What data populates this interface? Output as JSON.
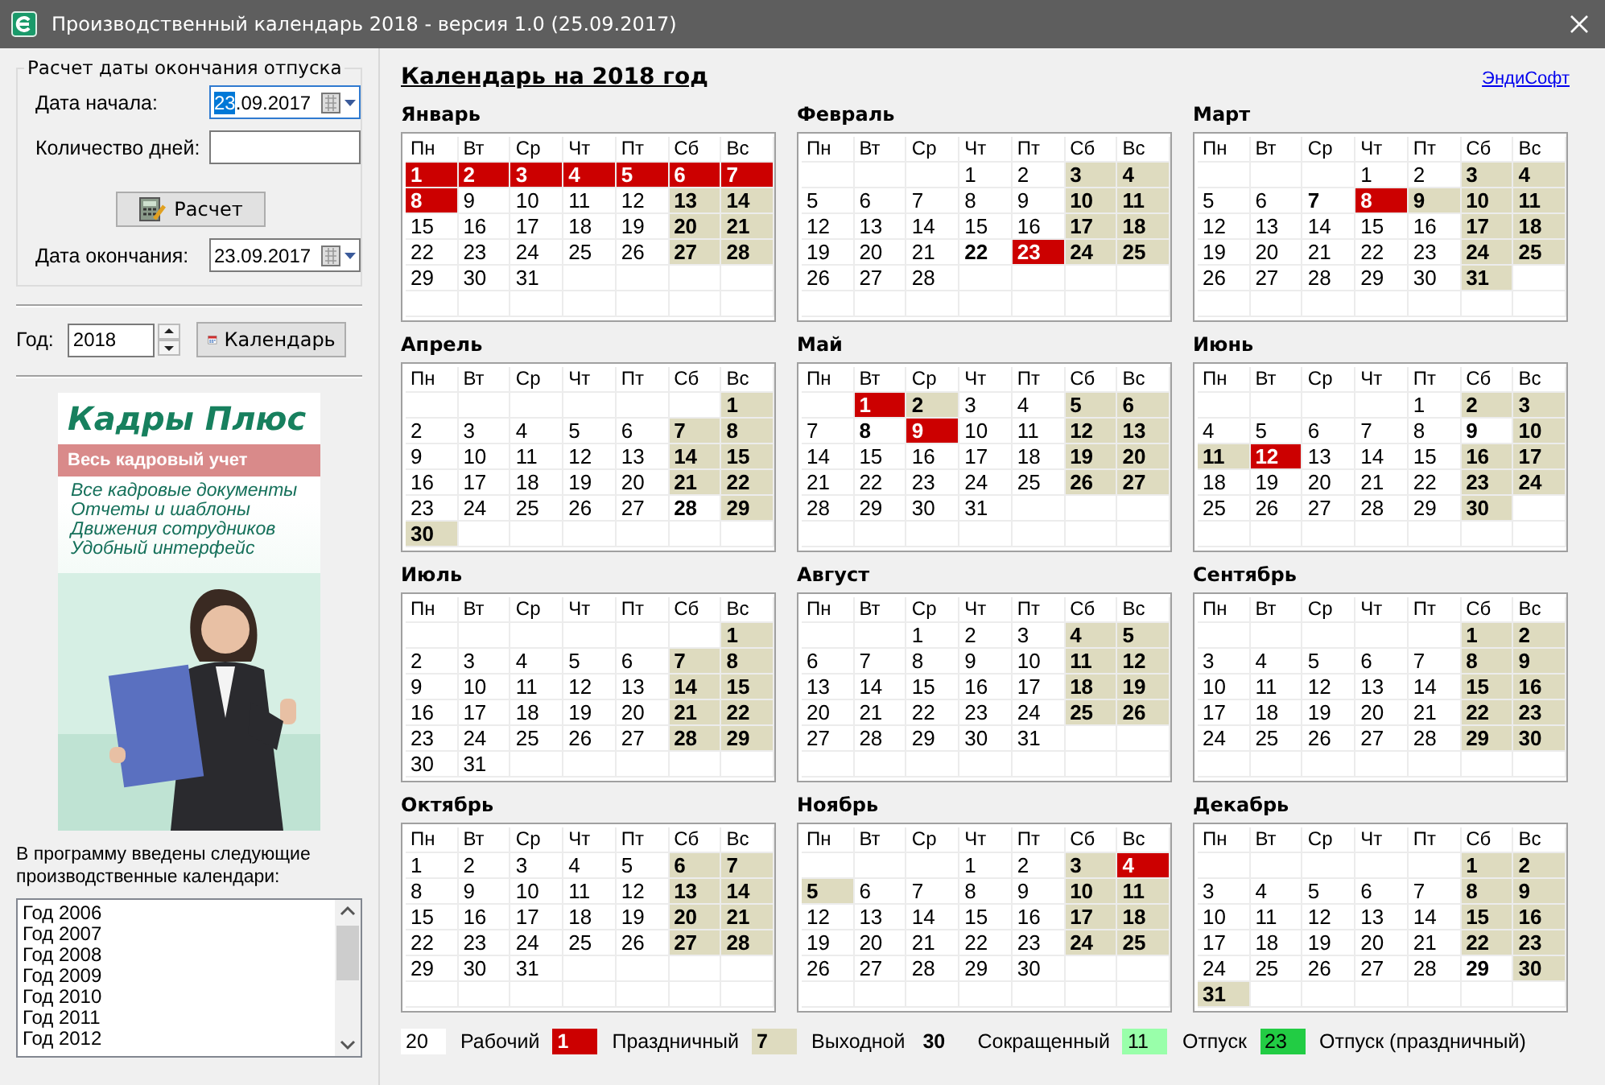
{
  "window": {
    "title": "Производственный календарь 2018 - версия 1.0 (25.09.2017)"
  },
  "vacation_calc": {
    "title": "Расчет даты окончания отпуска",
    "start_label": "Дата начала:",
    "start_value_selected": "23",
    "start_value_rest": ".09.2017",
    "days_label": "Количество дней:",
    "calc_button": "Расчет",
    "end_label": "Дата окончания:",
    "end_value": "23.09.2017"
  },
  "year": {
    "label": "Год:",
    "value": "2018",
    "button": "Календарь"
  },
  "ad": {
    "title": "Кадры Плюс",
    "subtitle": "Весь кадровый учет",
    "lines": [
      "Все кадровые документы",
      "Отчеты и шаблоны",
      "Движения сотрудников",
      "Удобный интерфейс"
    ]
  },
  "calendars_note": "В программу введены следующие производственные календари:",
  "calendars_list": [
    "Год 2006",
    "Год 2007",
    "Год 2008",
    "Год 2009",
    "Год 2010",
    "Год 2011",
    "Год 2012"
  ],
  "heading": "Календарь на 2018 год",
  "link": "ЭндиСофт",
  "months": [
    {
      "name": "Январь",
      "weekdays": [
        "Пн",
        "Вт",
        "Ср",
        "Чт",
        "Пт",
        "Сб",
        "Вс"
      ],
      "days": [
        {
          "day": "1",
          "kind": "holiday"
        },
        {
          "day": "2",
          "kind": "holiday"
        },
        {
          "day": "3",
          "kind": "holiday"
        },
        {
          "day": "4",
          "kind": "holiday"
        },
        {
          "day": "5",
          "kind": "holiday"
        },
        {
          "day": "6",
          "kind": "holiday"
        },
        {
          "day": "7",
          "kind": "holiday"
        },
        {
          "day": "8",
          "kind": "holiday"
        },
        {
          "day": "9",
          "kind": "work"
        },
        {
          "day": "10",
          "kind": "work"
        },
        {
          "day": "11",
          "kind": "work"
        },
        {
          "day": "12",
          "kind": "work"
        },
        {
          "day": "13",
          "kind": "weekend"
        },
        {
          "day": "14",
          "kind": "weekend"
        },
        {
          "day": "15",
          "kind": "work"
        },
        {
          "day": "16",
          "kind": "work"
        },
        {
          "day": "17",
          "kind": "work"
        },
        {
          "day": "18",
          "kind": "work"
        },
        {
          "day": "19",
          "kind": "work"
        },
        {
          "day": "20",
          "kind": "weekend"
        },
        {
          "day": "21",
          "kind": "weekend"
        },
        {
          "day": "22",
          "kind": "work"
        },
        {
          "day": "23",
          "kind": "work"
        },
        {
          "day": "24",
          "kind": "work"
        },
        {
          "day": "25",
          "kind": "work"
        },
        {
          "day": "26",
          "kind": "work"
        },
        {
          "day": "27",
          "kind": "weekend"
        },
        {
          "day": "28",
          "kind": "weekend"
        },
        {
          "day": "29",
          "kind": "work"
        },
        {
          "day": "30",
          "kind": "work"
        },
        {
          "day": "31",
          "kind": "work"
        }
      ]
    },
    {
      "name": "Февраль",
      "weekdays": [
        "Пн",
        "Вт",
        "Ср",
        "Чт",
        "Пт",
        "Сб",
        "Вс"
      ],
      "days": [
        {
          "kind": "blank"
        },
        {
          "kind": "blank"
        },
        {
          "kind": "blank"
        },
        {
          "day": "1",
          "kind": "work"
        },
        {
          "day": "2",
          "kind": "work"
        },
        {
          "day": "3",
          "kind": "weekend"
        },
        {
          "day": "4",
          "kind": "weekend"
        },
        {
          "day": "5",
          "kind": "work"
        },
        {
          "day": "6",
          "kind": "work"
        },
        {
          "day": "7",
          "kind": "work"
        },
        {
          "day": "8",
          "kind": "work"
        },
        {
          "day": "9",
          "kind": "work"
        },
        {
          "day": "10",
          "kind": "weekend"
        },
        {
          "day": "11",
          "kind": "weekend"
        },
        {
          "day": "12",
          "kind": "work"
        },
        {
          "day": "13",
          "kind": "work"
        },
        {
          "day": "14",
          "kind": "work"
        },
        {
          "day": "15",
          "kind": "work"
        },
        {
          "day": "16",
          "kind": "work"
        },
        {
          "day": "17",
          "kind": "weekend"
        },
        {
          "day": "18",
          "kind": "weekend"
        },
        {
          "day": "19",
          "kind": "work"
        },
        {
          "day": "20",
          "kind": "work"
        },
        {
          "day": "21",
          "kind": "work"
        },
        {
          "day": "22",
          "kind": "short"
        },
        {
          "day": "23",
          "kind": "holiday"
        },
        {
          "day": "24",
          "kind": "weekend"
        },
        {
          "day": "25",
          "kind": "weekend"
        },
        {
          "day": "26",
          "kind": "work"
        },
        {
          "day": "27",
          "kind": "work"
        },
        {
          "day": "28",
          "kind": "work"
        }
      ]
    },
    {
      "name": "Март",
      "weekdays": [
        "Пн",
        "Вт",
        "Ср",
        "Чт",
        "Пт",
        "Сб",
        "Вс"
      ],
      "days": [
        {
          "kind": "blank"
        },
        {
          "kind": "blank"
        },
        {
          "kind": "blank"
        },
        {
          "day": "1",
          "kind": "work"
        },
        {
          "day": "2",
          "kind": "work"
        },
        {
          "day": "3",
          "kind": "weekend"
        },
        {
          "day": "4",
          "kind": "weekend"
        },
        {
          "day": "5",
          "kind": "work"
        },
        {
          "day": "6",
          "kind": "work"
        },
        {
          "day": "7",
          "kind": "short"
        },
        {
          "day": "8",
          "kind": "holiday"
        },
        {
          "day": "9",
          "kind": "weekend"
        },
        {
          "day": "10",
          "kind": "weekend"
        },
        {
          "day": "11",
          "kind": "weekend"
        },
        {
          "day": "12",
          "kind": "work"
        },
        {
          "day": "13",
          "kind": "work"
        },
        {
          "day": "14",
          "kind": "work"
        },
        {
          "day": "15",
          "kind": "work"
        },
        {
          "day": "16",
          "kind": "work"
        },
        {
          "day": "17",
          "kind": "weekend"
        },
        {
          "day": "18",
          "kind": "weekend"
        },
        {
          "day": "19",
          "kind": "work"
        },
        {
          "day": "20",
          "kind": "work"
        },
        {
          "day": "21",
          "kind": "work"
        },
        {
          "day": "22",
          "kind": "work"
        },
        {
          "day": "23",
          "kind": "work"
        },
        {
          "day": "24",
          "kind": "weekend"
        },
        {
          "day": "25",
          "kind": "weekend"
        },
        {
          "day": "26",
          "kind": "work"
        },
        {
          "day": "27",
          "kind": "work"
        },
        {
          "day": "28",
          "kind": "work"
        },
        {
          "day": "29",
          "kind": "work"
        },
        {
          "day": "30",
          "kind": "work"
        },
        {
          "day": "31",
          "kind": "weekend"
        }
      ]
    },
    {
      "name": "Апрель",
      "weekdays": [
        "Пн",
        "Вт",
        "Ср",
        "Чт",
        "Пт",
        "Сб",
        "Вс"
      ],
      "days": [
        {
          "kind": "blank"
        },
        {
          "kind": "blank"
        },
        {
          "kind": "blank"
        },
        {
          "kind": "blank"
        },
        {
          "kind": "blank"
        },
        {
          "kind": "blank"
        },
        {
          "day": "1",
          "kind": "weekend"
        },
        {
          "day": "2",
          "kind": "work"
        },
        {
          "day": "3",
          "kind": "work"
        },
        {
          "day": "4",
          "kind": "work"
        },
        {
          "day": "5",
          "kind": "work"
        },
        {
          "day": "6",
          "kind": "work"
        },
        {
          "day": "7",
          "kind": "weekend"
        },
        {
          "day": "8",
          "kind": "weekend"
        },
        {
          "day": "9",
          "kind": "work"
        },
        {
          "day": "10",
          "kind": "work"
        },
        {
          "day": "11",
          "kind": "work"
        },
        {
          "day": "12",
          "kind": "work"
        },
        {
          "day": "13",
          "kind": "work"
        },
        {
          "day": "14",
          "kind": "weekend"
        },
        {
          "day": "15",
          "kind": "weekend"
        },
        {
          "day": "16",
          "kind": "work"
        },
        {
          "day": "17",
          "kind": "work"
        },
        {
          "day": "18",
          "kind": "work"
        },
        {
          "day": "19",
          "kind": "work"
        },
        {
          "day": "20",
          "kind": "work"
        },
        {
          "day": "21",
          "kind": "weekend"
        },
        {
          "day": "22",
          "kind": "weekend"
        },
        {
          "day": "23",
          "kind": "work"
        },
        {
          "day": "24",
          "kind": "work"
        },
        {
          "day": "25",
          "kind": "work"
        },
        {
          "day": "26",
          "kind": "work"
        },
        {
          "day": "27",
          "kind": "work"
        },
        {
          "day": "28",
          "kind": "short"
        },
        {
          "day": "29",
          "kind": "weekend"
        },
        {
          "day": "30",
          "kind": "weekend"
        }
      ]
    },
    {
      "name": "Май",
      "weekdays": [
        "Пн",
        "Вт",
        "Ср",
        "Чт",
        "Пт",
        "Сб",
        "Вс"
      ],
      "days": [
        {
          "kind": "blank"
        },
        {
          "day": "1",
          "kind": "holiday"
        },
        {
          "day": "2",
          "kind": "weekend"
        },
        {
          "day": "3",
          "kind": "work"
        },
        {
          "day": "4",
          "kind": "work"
        },
        {
          "day": "5",
          "kind": "weekend"
        },
        {
          "day": "6",
          "kind": "weekend"
        },
        {
          "day": "7",
          "kind": "work"
        },
        {
          "day": "8",
          "kind": "short"
        },
        {
          "day": "9",
          "kind": "holiday"
        },
        {
          "day": "10",
          "kind": "work"
        },
        {
          "day": "11",
          "kind": "work"
        },
        {
          "day": "12",
          "kind": "weekend"
        },
        {
          "day": "13",
          "kind": "weekend"
        },
        {
          "day": "14",
          "kind": "work"
        },
        {
          "day": "15",
          "kind": "work"
        },
        {
          "day": "16",
          "kind": "work"
        },
        {
          "day": "17",
          "kind": "work"
        },
        {
          "day": "18",
          "kind": "work"
        },
        {
          "day": "19",
          "kind": "weekend"
        },
        {
          "day": "20",
          "kind": "weekend"
        },
        {
          "day": "21",
          "kind": "work"
        },
        {
          "day": "22",
          "kind": "work"
        },
        {
          "day": "23",
          "kind": "work"
        },
        {
          "day": "24",
          "kind": "work"
        },
        {
          "day": "25",
          "kind": "work"
        },
        {
          "day": "26",
          "kind": "weekend"
        },
        {
          "day": "27",
          "kind": "weekend"
        },
        {
          "day": "28",
          "kind": "work"
        },
        {
          "day": "29",
          "kind": "work"
        },
        {
          "day": "30",
          "kind": "work"
        },
        {
          "day": "31",
          "kind": "work"
        }
      ]
    },
    {
      "name": "Июнь",
      "weekdays": [
        "Пн",
        "Вт",
        "Ср",
        "Чт",
        "Пт",
        "Сб",
        "Вс"
      ],
      "days": [
        {
          "kind": "blank"
        },
        {
          "kind": "blank"
        },
        {
          "kind": "blank"
        },
        {
          "kind": "blank"
        },
        {
          "day": "1",
          "kind": "work"
        },
        {
          "day": "2",
          "kind": "weekend"
        },
        {
          "day": "3",
          "kind": "weekend"
        },
        {
          "day": "4",
          "kind": "work"
        },
        {
          "day": "5",
          "kind": "work"
        },
        {
          "day": "6",
          "kind": "work"
        },
        {
          "day": "7",
          "kind": "work"
        },
        {
          "day": "8",
          "kind": "work"
        },
        {
          "day": "9",
          "kind": "short"
        },
        {
          "day": "10",
          "kind": "weekend"
        },
        {
          "day": "11",
          "kind": "weekend"
        },
        {
          "day": "12",
          "kind": "holiday"
        },
        {
          "day": "13",
          "kind": "work"
        },
        {
          "day": "14",
          "kind": "work"
        },
        {
          "day": "15",
          "kind": "work"
        },
        {
          "day": "16",
          "kind": "weekend"
        },
        {
          "day": "17",
          "kind": "weekend"
        },
        {
          "day": "18",
          "kind": "work"
        },
        {
          "day": "19",
          "kind": "work"
        },
        {
          "day": "20",
          "kind": "work"
        },
        {
          "day": "21",
          "kind": "work"
        },
        {
          "day": "22",
          "kind": "work"
        },
        {
          "day": "23",
          "kind": "weekend"
        },
        {
          "day": "24",
          "kind": "weekend"
        },
        {
          "day": "25",
          "kind": "work"
        },
        {
          "day": "26",
          "kind": "work"
        },
        {
          "day": "27",
          "kind": "work"
        },
        {
          "day": "28",
          "kind": "work"
        },
        {
          "day": "29",
          "kind": "work"
        },
        {
          "day": "30",
          "kind": "weekend"
        }
      ]
    },
    {
      "name": "Июль",
      "weekdays": [
        "Пн",
        "Вт",
        "Ср",
        "Чт",
        "Пт",
        "Сб",
        "Вс"
      ],
      "days": [
        {
          "kind": "blank"
        },
        {
          "kind": "blank"
        },
        {
          "kind": "blank"
        },
        {
          "kind": "blank"
        },
        {
          "kind": "blank"
        },
        {
          "kind": "blank"
        },
        {
          "day": "1",
          "kind": "weekend"
        },
        {
          "day": "2",
          "kind": "work"
        },
        {
          "day": "3",
          "kind": "work"
        },
        {
          "day": "4",
          "kind": "work"
        },
        {
          "day": "5",
          "kind": "work"
        },
        {
          "day": "6",
          "kind": "work"
        },
        {
          "day": "7",
          "kind": "weekend"
        },
        {
          "day": "8",
          "kind": "weekend"
        },
        {
          "day": "9",
          "kind": "work"
        },
        {
          "day": "10",
          "kind": "work"
        },
        {
          "day": "11",
          "kind": "work"
        },
        {
          "day": "12",
          "kind": "work"
        },
        {
          "day": "13",
          "kind": "work"
        },
        {
          "day": "14",
          "kind": "weekend"
        },
        {
          "day": "15",
          "kind": "weekend"
        },
        {
          "day": "16",
          "kind": "work"
        },
        {
          "day": "17",
          "kind": "work"
        },
        {
          "day": "18",
          "kind": "work"
        },
        {
          "day": "19",
          "kind": "work"
        },
        {
          "day": "20",
          "kind": "work"
        },
        {
          "day": "21",
          "kind": "weekend"
        },
        {
          "day": "22",
          "kind": "weekend"
        },
        {
          "day": "23",
          "kind": "work"
        },
        {
          "day": "24",
          "kind": "work"
        },
        {
          "day": "25",
          "kind": "work"
        },
        {
          "day": "26",
          "kind": "work"
        },
        {
          "day": "27",
          "kind": "work"
        },
        {
          "day": "28",
          "kind": "weekend"
        },
        {
          "day": "29",
          "kind": "weekend"
        },
        {
          "day": "30",
          "kind": "work"
        },
        {
          "day": "31",
          "kind": "work"
        }
      ]
    },
    {
      "name": "Август",
      "weekdays": [
        "Пн",
        "Вт",
        "Ср",
        "Чт",
        "Пт",
        "Сб",
        "Вс"
      ],
      "days": [
        {
          "kind": "blank"
        },
        {
          "kind": "blank"
        },
        {
          "day": "1",
          "kind": "work"
        },
        {
          "day": "2",
          "kind": "work"
        },
        {
          "day": "3",
          "kind": "work"
        },
        {
          "day": "4",
          "kind": "weekend"
        },
        {
          "day": "5",
          "kind": "weekend"
        },
        {
          "day": "6",
          "kind": "work"
        },
        {
          "day": "7",
          "kind": "work"
        },
        {
          "day": "8",
          "kind": "work"
        },
        {
          "day": "9",
          "kind": "work"
        },
        {
          "day": "10",
          "kind": "work"
        },
        {
          "day": "11",
          "kind": "weekend"
        },
        {
          "day": "12",
          "kind": "weekend"
        },
        {
          "day": "13",
          "kind": "work"
        },
        {
          "day": "14",
          "kind": "work"
        },
        {
          "day": "15",
          "kind": "work"
        },
        {
          "day": "16",
          "kind": "work"
        },
        {
          "day": "17",
          "kind": "work"
        },
        {
          "day": "18",
          "kind": "weekend"
        },
        {
          "day": "19",
          "kind": "weekend"
        },
        {
          "day": "20",
          "kind": "work"
        },
        {
          "day": "21",
          "kind": "work"
        },
        {
          "day": "22",
          "kind": "work"
        },
        {
          "day": "23",
          "kind": "work"
        },
        {
          "day": "24",
          "kind": "work"
        },
        {
          "day": "25",
          "kind": "weekend"
        },
        {
          "day": "26",
          "kind": "weekend"
        },
        {
          "day": "27",
          "kind": "work"
        },
        {
          "day": "28",
          "kind": "work"
        },
        {
          "day": "29",
          "kind": "work"
        },
        {
          "day": "30",
          "kind": "work"
        },
        {
          "day": "31",
          "kind": "work"
        }
      ]
    },
    {
      "name": "Сентябрь",
      "weekdays": [
        "Пн",
        "Вт",
        "Ср",
        "Чт",
        "Пт",
        "Сб",
        "Вс"
      ],
      "days": [
        {
          "kind": "blank"
        },
        {
          "kind": "blank"
        },
        {
          "kind": "blank"
        },
        {
          "kind": "blank"
        },
        {
          "kind": "blank"
        },
        {
          "day": "1",
          "kind": "weekend"
        },
        {
          "day": "2",
          "kind": "weekend"
        },
        {
          "day": "3",
          "kind": "work"
        },
        {
          "day": "4",
          "kind": "work"
        },
        {
          "day": "5",
          "kind": "work"
        },
        {
          "day": "6",
          "kind": "work"
        },
        {
          "day": "7",
          "kind": "work"
        },
        {
          "day": "8",
          "kind": "weekend"
        },
        {
          "day": "9",
          "kind": "weekend"
        },
        {
          "day": "10",
          "kind": "work"
        },
        {
          "day": "11",
          "kind": "work"
        },
        {
          "day": "12",
          "kind": "work"
        },
        {
          "day": "13",
          "kind": "work"
        },
        {
          "day": "14",
          "kind": "work"
        },
        {
          "day": "15",
          "kind": "weekend"
        },
        {
          "day": "16",
          "kind": "weekend"
        },
        {
          "day": "17",
          "kind": "work"
        },
        {
          "day": "18",
          "kind": "work"
        },
        {
          "day": "19",
          "kind": "work"
        },
        {
          "day": "20",
          "kind": "work"
        },
        {
          "day": "21",
          "kind": "work"
        },
        {
          "day": "22",
          "kind": "weekend"
        },
        {
          "day": "23",
          "kind": "weekend"
        },
        {
          "day": "24",
          "kind": "work"
        },
        {
          "day": "25",
          "kind": "work"
        },
        {
          "day": "26",
          "kind": "work"
        },
        {
          "day": "27",
          "kind": "work"
        },
        {
          "day": "28",
          "kind": "work"
        },
        {
          "day": "29",
          "kind": "weekend"
        },
        {
          "day": "30",
          "kind": "weekend"
        }
      ]
    },
    {
      "name": "Октябрь",
      "weekdays": [
        "Пн",
        "Вт",
        "Ср",
        "Чт",
        "Пт",
        "Сб",
        "Вс"
      ],
      "days": [
        {
          "day": "1",
          "kind": "work"
        },
        {
          "day": "2",
          "kind": "work"
        },
        {
          "day": "3",
          "kind": "work"
        },
        {
          "day": "4",
          "kind": "work"
        },
        {
          "day": "5",
          "kind": "work"
        },
        {
          "day": "6",
          "kind": "weekend"
        },
        {
          "day": "7",
          "kind": "weekend"
        },
        {
          "day": "8",
          "kind": "work"
        },
        {
          "day": "9",
          "kind": "work"
        },
        {
          "day": "10",
          "kind": "work"
        },
        {
          "day": "11",
          "kind": "work"
        },
        {
          "day": "12",
          "kind": "work"
        },
        {
          "day": "13",
          "kind": "weekend"
        },
        {
          "day": "14",
          "kind": "weekend"
        },
        {
          "day": "15",
          "kind": "work"
        },
        {
          "day": "16",
          "kind": "work"
        },
        {
          "day": "17",
          "kind": "work"
        },
        {
          "day": "18",
          "kind": "work"
        },
        {
          "day": "19",
          "kind": "work"
        },
        {
          "day": "20",
          "kind": "weekend"
        },
        {
          "day": "21",
          "kind": "weekend"
        },
        {
          "day": "22",
          "kind": "work"
        },
        {
          "day": "23",
          "kind": "work"
        },
        {
          "day": "24",
          "kind": "work"
        },
        {
          "day": "25",
          "kind": "work"
        },
        {
          "day": "26",
          "kind": "work"
        },
        {
          "day": "27",
          "kind": "weekend"
        },
        {
          "day": "28",
          "kind": "weekend"
        },
        {
          "day": "29",
          "kind": "work"
        },
        {
          "day": "30",
          "kind": "work"
        },
        {
          "day": "31",
          "kind": "work"
        }
      ]
    },
    {
      "name": "Ноябрь",
      "weekdays": [
        "Пн",
        "Вт",
        "Ср",
        "Чт",
        "Пт",
        "Сб",
        "Вс"
      ],
      "days": [
        {
          "kind": "blank"
        },
        {
          "kind": "blank"
        },
        {
          "kind": "blank"
        },
        {
          "day": "1",
          "kind": "work"
        },
        {
          "day": "2",
          "kind": "work"
        },
        {
          "day": "3",
          "kind": "weekend"
        },
        {
          "day": "4",
          "kind": "holiday"
        },
        {
          "day": "5",
          "kind": "weekend"
        },
        {
          "day": "6",
          "kind": "work"
        },
        {
          "day": "7",
          "kind": "work"
        },
        {
          "day": "8",
          "kind": "work"
        },
        {
          "day": "9",
          "kind": "work"
        },
        {
          "day": "10",
          "kind": "weekend"
        },
        {
          "day": "11",
          "kind": "weekend"
        },
        {
          "day": "12",
          "kind": "work"
        },
        {
          "day": "13",
          "kind": "work"
        },
        {
          "day": "14",
          "kind": "work"
        },
        {
          "day": "15",
          "kind": "work"
        },
        {
          "day": "16",
          "kind": "work"
        },
        {
          "day": "17",
          "kind": "weekend"
        },
        {
          "day": "18",
          "kind": "weekend"
        },
        {
          "day": "19",
          "kind": "work"
        },
        {
          "day": "20",
          "kind": "work"
        },
        {
          "day": "21",
          "kind": "work"
        },
        {
          "day": "22",
          "kind": "work"
        },
        {
          "day": "23",
          "kind": "work"
        },
        {
          "day": "24",
          "kind": "weekend"
        },
        {
          "day": "25",
          "kind": "weekend"
        },
        {
          "day": "26",
          "kind": "work"
        },
        {
          "day": "27",
          "kind": "work"
        },
        {
          "day": "28",
          "kind": "work"
        },
        {
          "day": "29",
          "kind": "work"
        },
        {
          "day": "30",
          "kind": "work"
        }
      ]
    },
    {
      "name": "Декабрь",
      "weekdays": [
        "Пн",
        "Вт",
        "Ср",
        "Чт",
        "Пт",
        "Сб",
        "Вс"
      ],
      "days": [
        {
          "kind": "blank"
        },
        {
          "kind": "blank"
        },
        {
          "kind": "blank"
        },
        {
          "kind": "blank"
        },
        {
          "kind": "blank"
        },
        {
          "day": "1",
          "kind": "weekend"
        },
        {
          "day": "2",
          "kind": "weekend"
        },
        {
          "day": "3",
          "kind": "work"
        },
        {
          "day": "4",
          "kind": "work"
        },
        {
          "day": "5",
          "kind": "work"
        },
        {
          "day": "6",
          "kind": "work"
        },
        {
          "day": "7",
          "kind": "work"
        },
        {
          "day": "8",
          "kind": "weekend"
        },
        {
          "day": "9",
          "kind": "weekend"
        },
        {
          "day": "10",
          "kind": "work"
        },
        {
          "day": "11",
          "kind": "work"
        },
        {
          "day": "12",
          "kind": "work"
        },
        {
          "day": "13",
          "kind": "work"
        },
        {
          "day": "14",
          "kind": "work"
        },
        {
          "day": "15",
          "kind": "weekend"
        },
        {
          "day": "16",
          "kind": "weekend"
        },
        {
          "day": "17",
          "kind": "work"
        },
        {
          "day": "18",
          "kind": "work"
        },
        {
          "day": "19",
          "kind": "work"
        },
        {
          "day": "20",
          "kind": "work"
        },
        {
          "day": "21",
          "kind": "work"
        },
        {
          "day": "22",
          "kind": "weekend"
        },
        {
          "day": "23",
          "kind": "weekend"
        },
        {
          "day": "24",
          "kind": "work"
        },
        {
          "day": "25",
          "kind": "work"
        },
        {
          "day": "26",
          "kind": "work"
        },
        {
          "day": "27",
          "kind": "work"
        },
        {
          "day": "28",
          "kind": "work"
        },
        {
          "day": "29",
          "kind": "short"
        },
        {
          "day": "30",
          "kind": "weekend"
        },
        {
          "day": "31",
          "kind": "weekend"
        }
      ]
    }
  ],
  "legend": [
    {
      "sample": "20",
      "label": "Рабочий",
      "kind": "work"
    },
    {
      "sample": "1",
      "label": "Праздничный",
      "kind": "holiday"
    },
    {
      "sample": "7",
      "label": "Выходной",
      "kind": "weekend"
    },
    {
      "sample": "30",
      "label": "Сокращенный",
      "kind": "short"
    },
    {
      "sample": "11",
      "label": "Отпуск",
      "kind": "vacation"
    },
    {
      "sample": "23",
      "label": "Отпуск (праздничный)",
      "kind": "vacation_holiday"
    }
  ]
}
